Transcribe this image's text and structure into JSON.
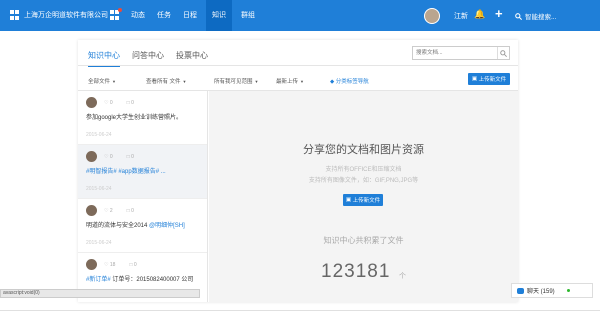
{
  "topbar": {
    "company": "上海万企明道软件有限公司",
    "nav": [
      {
        "label": "动态"
      },
      {
        "label": "任务"
      },
      {
        "label": "日程"
      },
      {
        "label": "知识"
      },
      {
        "label": "群组"
      }
    ],
    "active_nav": "知识",
    "username": "江新",
    "search_label": "智能搜索..."
  },
  "tabs": [
    {
      "label": "知识中心"
    },
    {
      "label": "问答中心"
    },
    {
      "label": "投票中心"
    }
  ],
  "active_tab": "知识中心",
  "search": {
    "placeholder": "搜索文档..."
  },
  "filters": {
    "all_files": "全部文件",
    "view_all": "查看所有 文件",
    "all_scope": "所有我可见范围",
    "latest_upload": "最新上传",
    "category_nav": "分类标签导航"
  },
  "upload_label": "上传新文件",
  "feed": [
    {
      "likes": "0",
      "comments": "0",
      "text": "参加google大学生创业训练营照片。",
      "tag_text": "",
      "date": "2015-06-24"
    },
    {
      "likes": "0",
      "comments": "0",
      "text": "",
      "tag_text": "#明智报告# #app数据报告# ...",
      "date": "2015-06-24"
    },
    {
      "likes": "2",
      "comments": "0",
      "text": "明道的流体与安全2014 ",
      "tag_text": "@明细仲[SH]",
      "date": "2015-06-24"
    },
    {
      "likes": "18",
      "comments": "0",
      "text": " 订单号：2015082400007 公司",
      "tag_text": "#新订单#",
      "date": ""
    }
  ],
  "content": {
    "headline": "分享您的文档和图片资源",
    "sub1": "支持所有OFFICE和压缩文档",
    "sub2": "支持所有图像文件，如：GIF,PNG,JPG等",
    "button": "上传新文件",
    "shared_label": "知识中心共积累了文件",
    "count": "123181",
    "unit": "个"
  },
  "statusbar": "avascript:void(0)",
  "chat": {
    "label": "聊天 (159)"
  },
  "colors": {
    "brand": "#1f7fd8",
    "online": "#2eb82e"
  }
}
